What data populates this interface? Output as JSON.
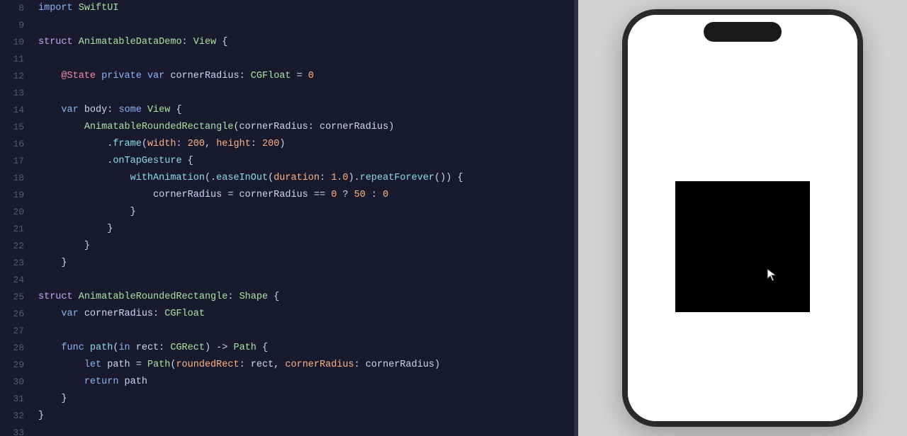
{
  "editor": {
    "background": "#1a1a2e",
    "lines": [
      {
        "num": "8",
        "tokens": [
          {
            "text": "import ",
            "cls": "kw-import"
          },
          {
            "text": "SwiftUI",
            "cls": "type-name"
          }
        ]
      },
      {
        "num": "9",
        "tokens": []
      },
      {
        "num": "10",
        "tokens": [
          {
            "text": "struct ",
            "cls": "kw-struct"
          },
          {
            "text": "AnimatableDataDemo",
            "cls": "type-name"
          },
          {
            "text": ": ",
            "cls": "plain"
          },
          {
            "text": "View",
            "cls": "type-name"
          },
          {
            "text": " {",
            "cls": "plain"
          }
        ]
      },
      {
        "num": "11",
        "tokens": []
      },
      {
        "num": "12",
        "tokens": [
          {
            "text": "    ",
            "cls": "plain"
          },
          {
            "text": "@State",
            "cls": "attr-name"
          },
          {
            "text": " ",
            "cls": "plain"
          },
          {
            "text": "private",
            "cls": "kw-private"
          },
          {
            "text": " ",
            "cls": "plain"
          },
          {
            "text": "var",
            "cls": "kw-var"
          },
          {
            "text": " cornerRadius: ",
            "cls": "plain"
          },
          {
            "text": "CGFloat",
            "cls": "type-name"
          },
          {
            "text": " = ",
            "cls": "plain"
          },
          {
            "text": "0",
            "cls": "number-lit"
          }
        ]
      },
      {
        "num": "13",
        "tokens": []
      },
      {
        "num": "14",
        "tokens": [
          {
            "text": "    ",
            "cls": "plain"
          },
          {
            "text": "var",
            "cls": "kw-var"
          },
          {
            "text": " body: ",
            "cls": "plain"
          },
          {
            "text": "some",
            "cls": "kw-some"
          },
          {
            "text": " ",
            "cls": "plain"
          },
          {
            "text": "View",
            "cls": "type-name"
          },
          {
            "text": " {",
            "cls": "plain"
          }
        ]
      },
      {
        "num": "15",
        "tokens": [
          {
            "text": "        ",
            "cls": "plain"
          },
          {
            "text": "AnimatableRoundedRectangle",
            "cls": "type-name"
          },
          {
            "text": "(cornerRadius: cornerRadius)",
            "cls": "plain"
          }
        ]
      },
      {
        "num": "16",
        "tokens": [
          {
            "text": "            ",
            "cls": "plain"
          },
          {
            "text": ".",
            "cls": "plain"
          },
          {
            "text": "frame",
            "cls": "method-name"
          },
          {
            "text": "(",
            "cls": "plain"
          },
          {
            "text": "width",
            "cls": "param-name"
          },
          {
            "text": ": ",
            "cls": "plain"
          },
          {
            "text": "200",
            "cls": "number-lit"
          },
          {
            "text": ", ",
            "cls": "plain"
          },
          {
            "text": "height",
            "cls": "param-name"
          },
          {
            "text": ": ",
            "cls": "plain"
          },
          {
            "text": "200",
            "cls": "number-lit"
          },
          {
            "text": ")",
            "cls": "plain"
          }
        ]
      },
      {
        "num": "17",
        "tokens": [
          {
            "text": "            ",
            "cls": "plain"
          },
          {
            "text": ".",
            "cls": "plain"
          },
          {
            "text": "onTapGesture",
            "cls": "method-name"
          },
          {
            "text": " {",
            "cls": "plain"
          }
        ]
      },
      {
        "num": "18",
        "tokens": [
          {
            "text": "                ",
            "cls": "plain"
          },
          {
            "text": "withAnimation",
            "cls": "method-name"
          },
          {
            "text": "(.",
            "cls": "plain"
          },
          {
            "text": "easeInOut",
            "cls": "method-name"
          },
          {
            "text": "(",
            "cls": "plain"
          },
          {
            "text": "duration",
            "cls": "param-name"
          },
          {
            "text": ": ",
            "cls": "plain"
          },
          {
            "text": "1.0",
            "cls": "number-lit"
          },
          {
            "text": ").",
            "cls": "plain"
          },
          {
            "text": "repeatForever",
            "cls": "method-name"
          },
          {
            "text": "()) {",
            "cls": "plain"
          }
        ]
      },
      {
        "num": "19",
        "tokens": [
          {
            "text": "                    ",
            "cls": "plain"
          },
          {
            "text": "cornerRadius",
            "cls": "plain"
          },
          {
            "text": " = cornerRadius == ",
            "cls": "plain"
          },
          {
            "text": "0",
            "cls": "number-lit"
          },
          {
            "text": " ? ",
            "cls": "plain"
          },
          {
            "text": "50",
            "cls": "number-lit"
          },
          {
            "text": " : ",
            "cls": "plain"
          },
          {
            "text": "0",
            "cls": "number-lit"
          }
        ]
      },
      {
        "num": "20",
        "tokens": [
          {
            "text": "                ",
            "cls": "plain"
          },
          {
            "text": "}",
            "cls": "plain"
          }
        ]
      },
      {
        "num": "21",
        "tokens": [
          {
            "text": "            ",
            "cls": "plain"
          },
          {
            "text": "}",
            "cls": "plain"
          }
        ]
      },
      {
        "num": "22",
        "tokens": [
          {
            "text": "        ",
            "cls": "plain"
          },
          {
            "text": "}",
            "cls": "plain"
          }
        ]
      },
      {
        "num": "23",
        "tokens": [
          {
            "text": "    ",
            "cls": "plain"
          },
          {
            "text": "}",
            "cls": "plain"
          }
        ]
      },
      {
        "num": "24",
        "tokens": []
      },
      {
        "num": "25",
        "tokens": [
          {
            "text": "struct ",
            "cls": "kw-struct"
          },
          {
            "text": "AnimatableRoundedRectangle",
            "cls": "type-name"
          },
          {
            "text": ": ",
            "cls": "plain"
          },
          {
            "text": "Shape",
            "cls": "type-name"
          },
          {
            "text": " {",
            "cls": "plain"
          }
        ]
      },
      {
        "num": "26",
        "tokens": [
          {
            "text": "    ",
            "cls": "plain"
          },
          {
            "text": "var",
            "cls": "kw-var"
          },
          {
            "text": " cornerRadius: ",
            "cls": "plain"
          },
          {
            "text": "CGFloat",
            "cls": "type-name"
          }
        ]
      },
      {
        "num": "27",
        "tokens": []
      },
      {
        "num": "28",
        "tokens": [
          {
            "text": "    ",
            "cls": "plain"
          },
          {
            "text": "func",
            "cls": "kw-func"
          },
          {
            "text": " ",
            "cls": "plain"
          },
          {
            "text": "path",
            "cls": "method-name"
          },
          {
            "text": "(",
            "cls": "plain"
          },
          {
            "text": "in",
            "cls": "kw-import"
          },
          {
            "text": " rect: ",
            "cls": "plain"
          },
          {
            "text": "CGRect",
            "cls": "type-name"
          },
          {
            "text": ") -> ",
            "cls": "plain"
          },
          {
            "text": "Path",
            "cls": "type-name"
          },
          {
            "text": " {",
            "cls": "plain"
          }
        ]
      },
      {
        "num": "29",
        "tokens": [
          {
            "text": "        ",
            "cls": "plain"
          },
          {
            "text": "let",
            "cls": "kw-let"
          },
          {
            "text": " path = ",
            "cls": "plain"
          },
          {
            "text": "Path",
            "cls": "type-name"
          },
          {
            "text": "(",
            "cls": "plain"
          },
          {
            "text": "roundedRect",
            "cls": "param-name"
          },
          {
            "text": ": rect, ",
            "cls": "plain"
          },
          {
            "text": "cornerRadius",
            "cls": "param-name"
          },
          {
            "text": ": cornerRadius)",
            "cls": "plain"
          }
        ]
      },
      {
        "num": "30",
        "tokens": [
          {
            "text": "        ",
            "cls": "plain"
          },
          {
            "text": "return",
            "cls": "kw-return"
          },
          {
            "text": " path",
            "cls": "plain"
          }
        ]
      },
      {
        "num": "31",
        "tokens": [
          {
            "text": "    ",
            "cls": "plain"
          },
          {
            "text": "}",
            "cls": "plain"
          }
        ]
      },
      {
        "num": "32",
        "tokens": [
          {
            "text": "}",
            "cls": "plain"
          }
        ]
      },
      {
        "num": "33",
        "tokens": []
      }
    ]
  },
  "preview": {
    "phone": {
      "background": "#ffffff",
      "notch_color": "#1a1a1a",
      "border_color": "#2a2a2a"
    },
    "square": {
      "background": "#000000"
    }
  }
}
